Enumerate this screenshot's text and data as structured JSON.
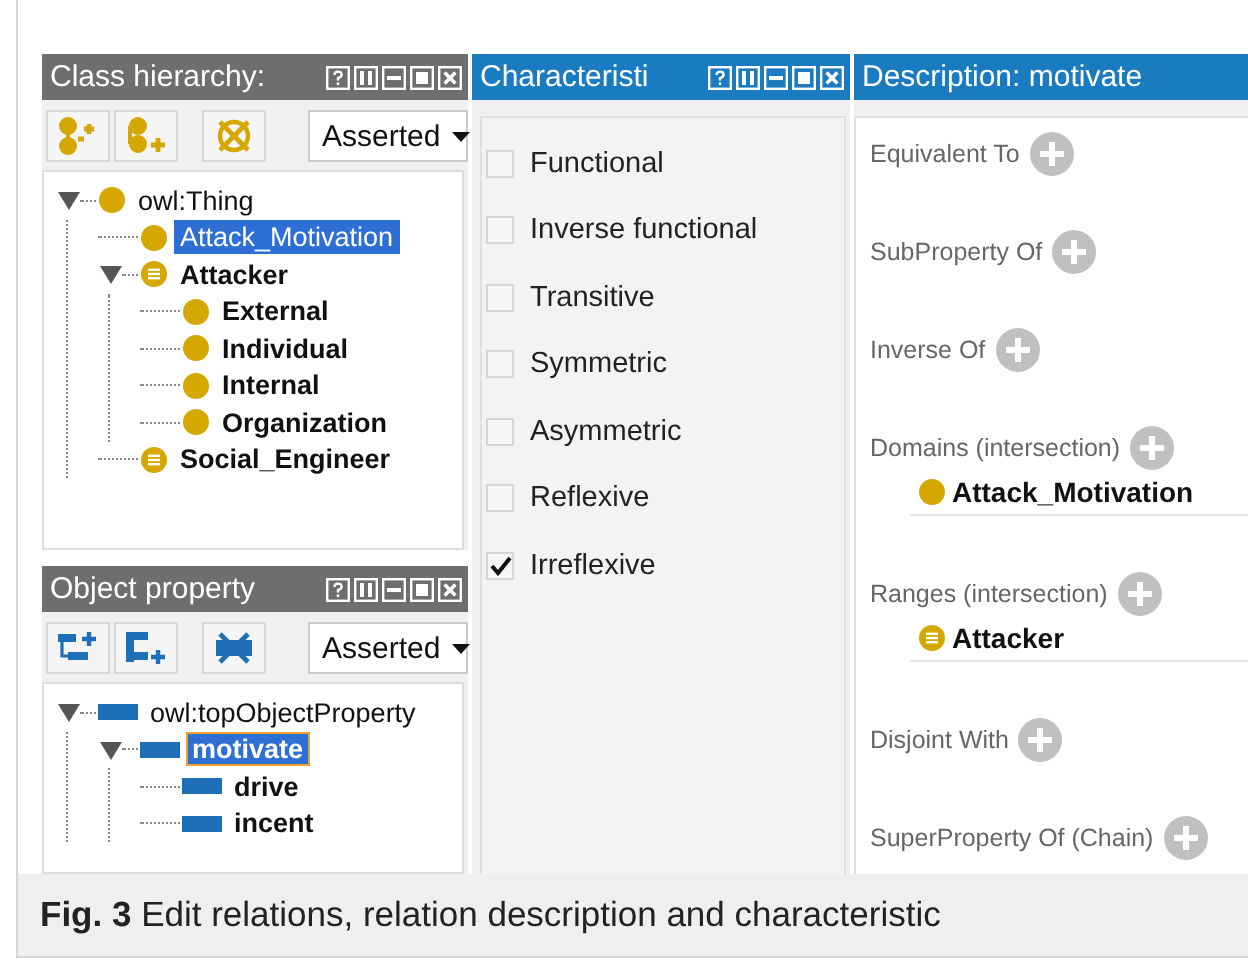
{
  "class_hierarchy": {
    "title": "Class hierarchy:",
    "active": false,
    "kind": "class",
    "view": "Asserted",
    "tree": [
      {
        "label": "owl:Thing",
        "kind": "class",
        "bold": false,
        "expanded": true,
        "selected": false,
        "children": [
          {
            "label": "Attack_Motivation",
            "kind": "class",
            "bold": false,
            "expanded": false,
            "selected": true
          },
          {
            "label": "Attacker",
            "kind": "defined",
            "bold": true,
            "expanded": true,
            "selected": false,
            "children": [
              {
                "label": "External",
                "kind": "class",
                "bold": true,
                "expanded": false,
                "selected": false
              },
              {
                "label": "Individual",
                "kind": "class",
                "bold": true,
                "expanded": false,
                "selected": false
              },
              {
                "label": "Internal",
                "kind": "class",
                "bold": true,
                "expanded": false,
                "selected": false
              },
              {
                "label": "Organization",
                "kind": "class",
                "bold": true,
                "expanded": false,
                "selected": false
              }
            ]
          },
          {
            "label": "Social_Engineer",
            "kind": "defined",
            "bold": true,
            "expanded": false,
            "selected": false
          }
        ]
      }
    ]
  },
  "object_property": {
    "title": "Object property",
    "active": false,
    "kind": "property",
    "view": "Asserted",
    "tree": [
      {
        "label": "owl:topObjectProperty",
        "kind": "property",
        "bold": false,
        "expanded": true,
        "selected": false,
        "children": [
          {
            "label": "motivate",
            "kind": "property",
            "bold": true,
            "expanded": true,
            "selected": true,
            "children": [
              {
                "label": "drive",
                "kind": "property",
                "bold": true,
                "expanded": false,
                "selected": false
              },
              {
                "label": "incent",
                "kind": "property",
                "bold": true,
                "expanded": false,
                "selected": false
              }
            ]
          }
        ]
      }
    ]
  },
  "characteristics": {
    "title": "Characteristi",
    "active": true,
    "items": [
      {
        "label": "Functional",
        "checked": false
      },
      {
        "label": "Inverse functional",
        "checked": false
      },
      {
        "label": "Transitive",
        "checked": false
      },
      {
        "label": "Symmetric",
        "checked": false
      },
      {
        "label": "Asymmetric",
        "checked": false
      },
      {
        "label": "Reflexive",
        "checked": false
      },
      {
        "label": "Irreflexive",
        "checked": true
      }
    ]
  },
  "description": {
    "title": "Description: motivate",
    "active": true,
    "sections": [
      {
        "label": "Equivalent To"
      },
      {
        "label": "SubProperty Of"
      },
      {
        "label": "Inverse Of"
      },
      {
        "label": "Domains (intersection)",
        "items": [
          {
            "label": "Attack_Motivation",
            "kind": "class"
          }
        ]
      },
      {
        "label": "Ranges (intersection)",
        "items": [
          {
            "label": "Attacker",
            "kind": "defined"
          }
        ]
      },
      {
        "label": "Disjoint With"
      },
      {
        "label": "SuperProperty Of (Chain)"
      }
    ]
  },
  "caption": "**Fig. 3** Edit relations, relation description and characteristic"
}
